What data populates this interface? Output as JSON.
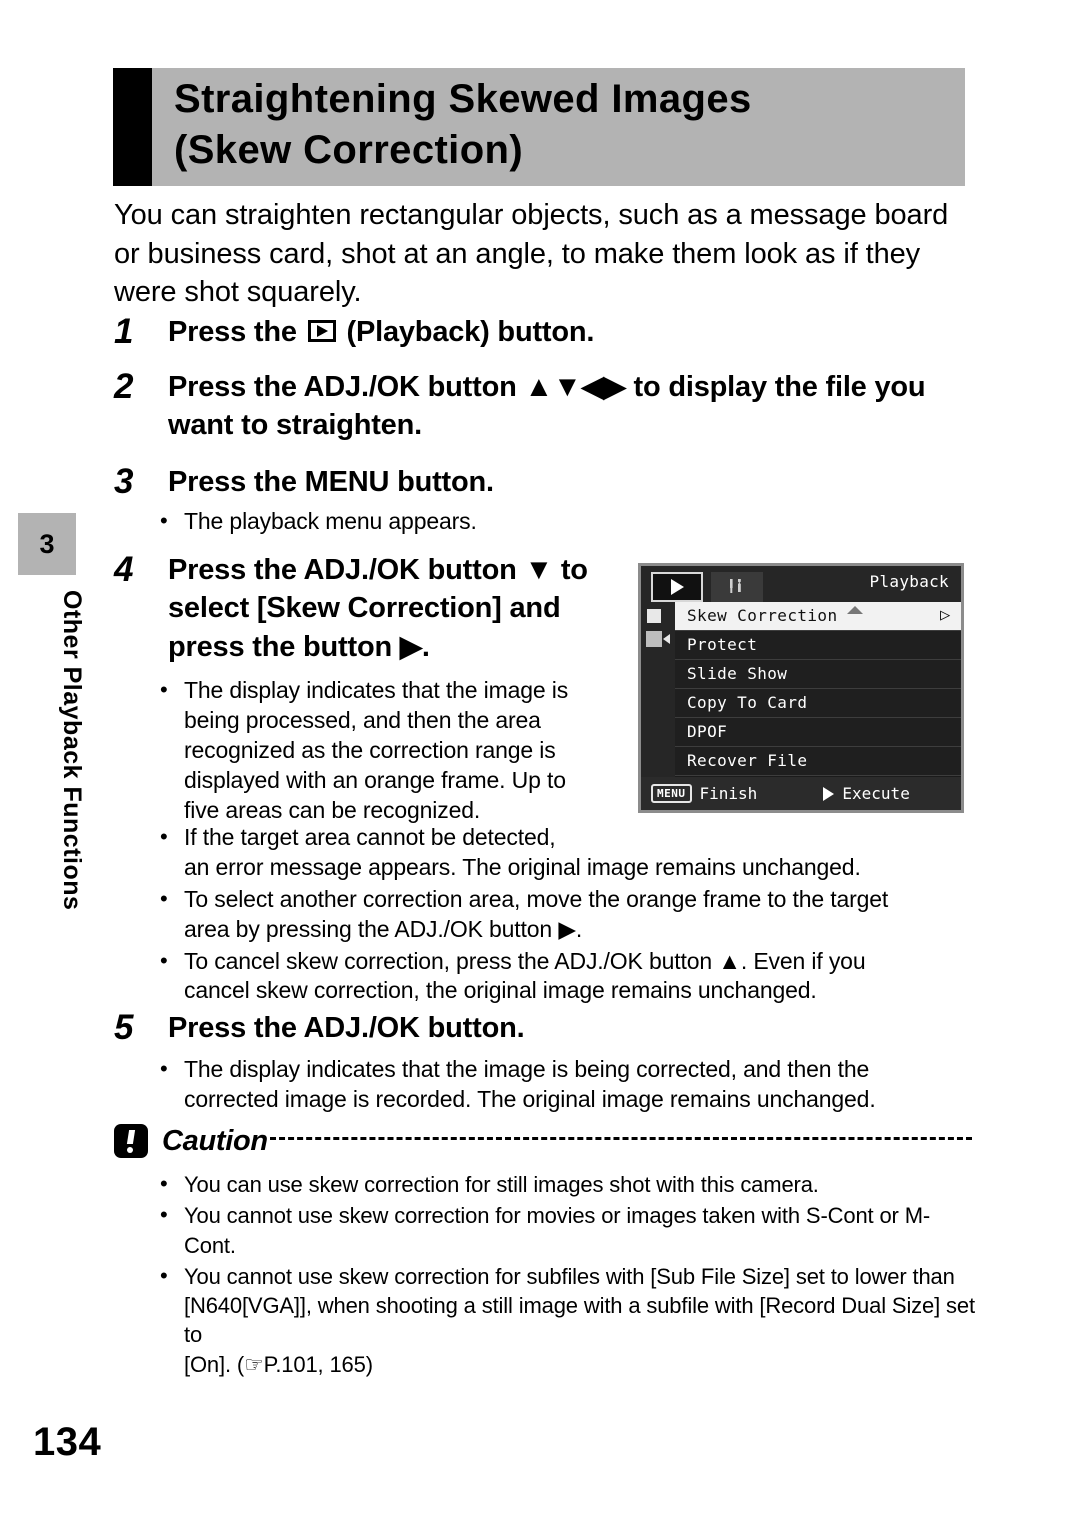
{
  "sidebar": {
    "chapter_number": "3",
    "chapter_title": "Other Playback Functions"
  },
  "heading": {
    "line1": "Straightening Skewed Images",
    "line2": "(Skew Correction)"
  },
  "intro": {
    "line1": "You can straighten rectangular objects, such as a message board",
    "line2": "or business card, shot at an angle, to make them look as if they",
    "line3": "were shot squarely."
  },
  "steps": [
    {
      "number": "1",
      "lines": [
        "Press the ",
        " (Playback) button."
      ],
      "icon": "playback-button-icon"
    },
    {
      "number": "2",
      "line1": "Press the ADJ./OK button ▲▼◀▶ to display the file you",
      "line2": "want to straighten."
    },
    {
      "number": "3",
      "line1": "Press the MENU button.",
      "bullets": [
        "The playback menu appears."
      ]
    },
    {
      "number": "4",
      "line1": "Press the ADJ./OK button ▼ to",
      "line2": "select [Skew Correction] and",
      "line3": "press the button ▶."
    },
    {
      "number": "5",
      "line1": "Press the ADJ./OK button."
    }
  ],
  "step4_bullets_narrow": [
    [
      "The display indicates that the image is",
      "being processed, and then the area",
      "recognized as the correction range is",
      "displayed with an orange frame. Up to",
      "five areas can be recognized."
    ]
  ],
  "step4_bullets_wide": [
    [
      "If the target area cannot be detected,",
      "an error message appears. The original image remains unchanged."
    ],
    [
      "To select another correction area, move the orange frame to the target",
      "area by pressing the ADJ./OK button ▶."
    ],
    [
      "To cancel skew correction, press the ADJ./OK button ▲. Even if you",
      "cancel skew correction, the original image remains unchanged."
    ]
  ],
  "step5_bullets": [
    [
      "The display indicates that the image is being corrected, and then the",
      "corrected image is recorded. The original image remains unchanged."
    ]
  ],
  "caution": {
    "label": "Caution",
    "icon": "caution-exclamation-icon",
    "bullets": [
      [
        "You can use skew correction for still images shot with this camera."
      ],
      [
        "You cannot use skew correction for movies or images taken with S-Cont or M-Cont."
      ],
      [
        "You cannot use skew correction for subfiles with [Sub File Size] set to lower than",
        "[N640[VGA]], when shooting a still image with a subfile with [Record Dual Size] set to",
        "[On]. (☞P.101, 165)"
      ]
    ]
  },
  "camera_screen": {
    "title": "Playback",
    "tabs": [
      {
        "name": "playback-tab",
        "icon": "play-icon",
        "active": true
      },
      {
        "name": "setup-tab",
        "icon": "tools-icon",
        "active": false
      }
    ],
    "menu_items": [
      {
        "label": "Skew Correction",
        "selected": true
      },
      {
        "label": "Protect",
        "selected": false
      },
      {
        "label": "Slide Show",
        "selected": false
      },
      {
        "label": "Copy To Card",
        "selected": false
      },
      {
        "label": "DPOF",
        "selected": false
      },
      {
        "label": "Recover File",
        "selected": false
      }
    ],
    "footer": {
      "menu_key": "MENU",
      "finish_label": "Finish",
      "execute_label": "Execute"
    }
  },
  "page_number": "134",
  "colors": {
    "heading_background": "#b3b3b3",
    "heading_bar": "#000000",
    "lcd_background": "#1b1b1b",
    "lcd_selected": "#f2f2f2"
  }
}
